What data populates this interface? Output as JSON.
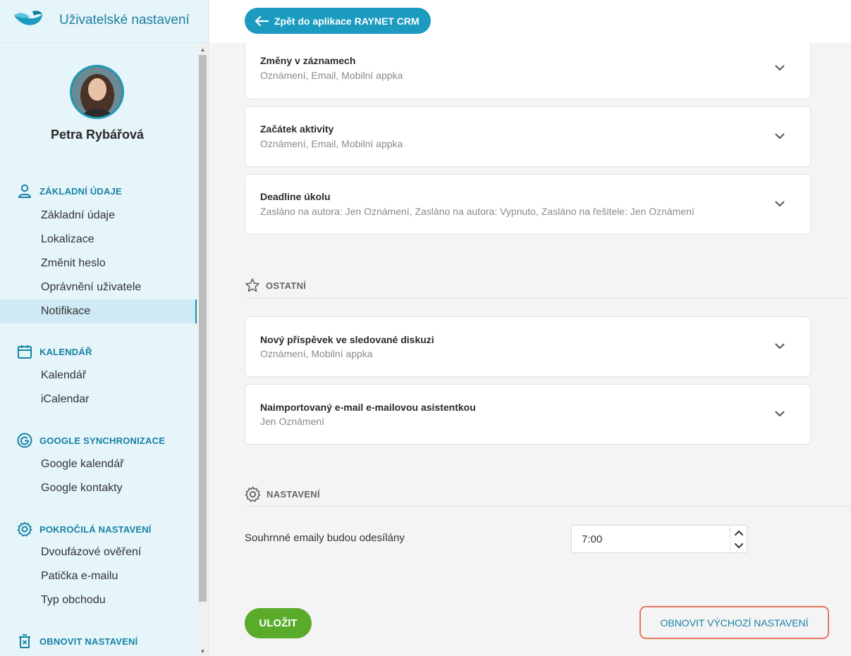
{
  "brand": {
    "title": "Uživatelské nastavení",
    "logo_icon": "raynet-bird-logo"
  },
  "profile": {
    "name": "Petra Rybářová"
  },
  "sidebar": {
    "sections": [
      {
        "label": "ZÁKLADNÍ ÚDAJE",
        "icon": "person-icon",
        "items": [
          "Základní údaje",
          "Lokalizace",
          "Změnit heslo",
          "Oprávnění uživatele",
          "Notifikace"
        ]
      },
      {
        "label": "KALENDÁŘ",
        "icon": "calendar-icon",
        "items": [
          "Kalendář",
          "iCalendar"
        ]
      },
      {
        "label": "GOOGLE SYNCHRONIZACE",
        "icon": "google-icon",
        "items": [
          "Google kalendář",
          "Google kontakty"
        ]
      },
      {
        "label": "POKROČILÁ NASTAVENÍ",
        "icon": "gear-icon",
        "items": [
          "Dvoufázové ověření",
          "Patička e-mailu",
          "Typ obchodu"
        ]
      },
      {
        "label": "OBNOVIT NASTAVENÍ",
        "icon": "trash-icon",
        "items": []
      }
    ],
    "active_item": "Notifikace"
  },
  "topbar": {
    "back_label": "Zpět do aplikace RAYNET CRM"
  },
  "cards_top": [
    {
      "title": "Změny v záznamech",
      "sub": "Oznámení, Email, Mobilní appka"
    },
    {
      "title": "Začátek aktivity",
      "sub": "Oznámení, Email, Mobilní appka"
    },
    {
      "title": "Deadline úkolu",
      "sub": "Zasláno na autora: Jen Oznámení, Zasláno na autora: Vypnuto, Zasláno na řešitele: Jen Oznámení"
    }
  ],
  "section_other": {
    "label": "OSTATNÍ",
    "icon": "star-icon"
  },
  "cards_other": [
    {
      "title": "Nový příspěvek ve sledované diskuzi",
      "sub": "Oznámení, Mobilní appka"
    },
    {
      "title": "Naimportovaný e-mail e-mailovou asistentkou",
      "sub": "Jen Oznámení"
    }
  ],
  "section_settings": {
    "label": "NASTAVENÍ",
    "icon": "gear-icon"
  },
  "settings": {
    "summary_label": "Souhrnné emaily budou odesílány",
    "summary_time": "7:00"
  },
  "actions": {
    "save_label": "ULOŽIT",
    "reset_label": "OBNOVIT VÝCHOZÍ NASTAVENÍ"
  },
  "colors": {
    "accent": "#1a9bbf",
    "save": "#5aab2a",
    "highlight": "#e8775f"
  }
}
